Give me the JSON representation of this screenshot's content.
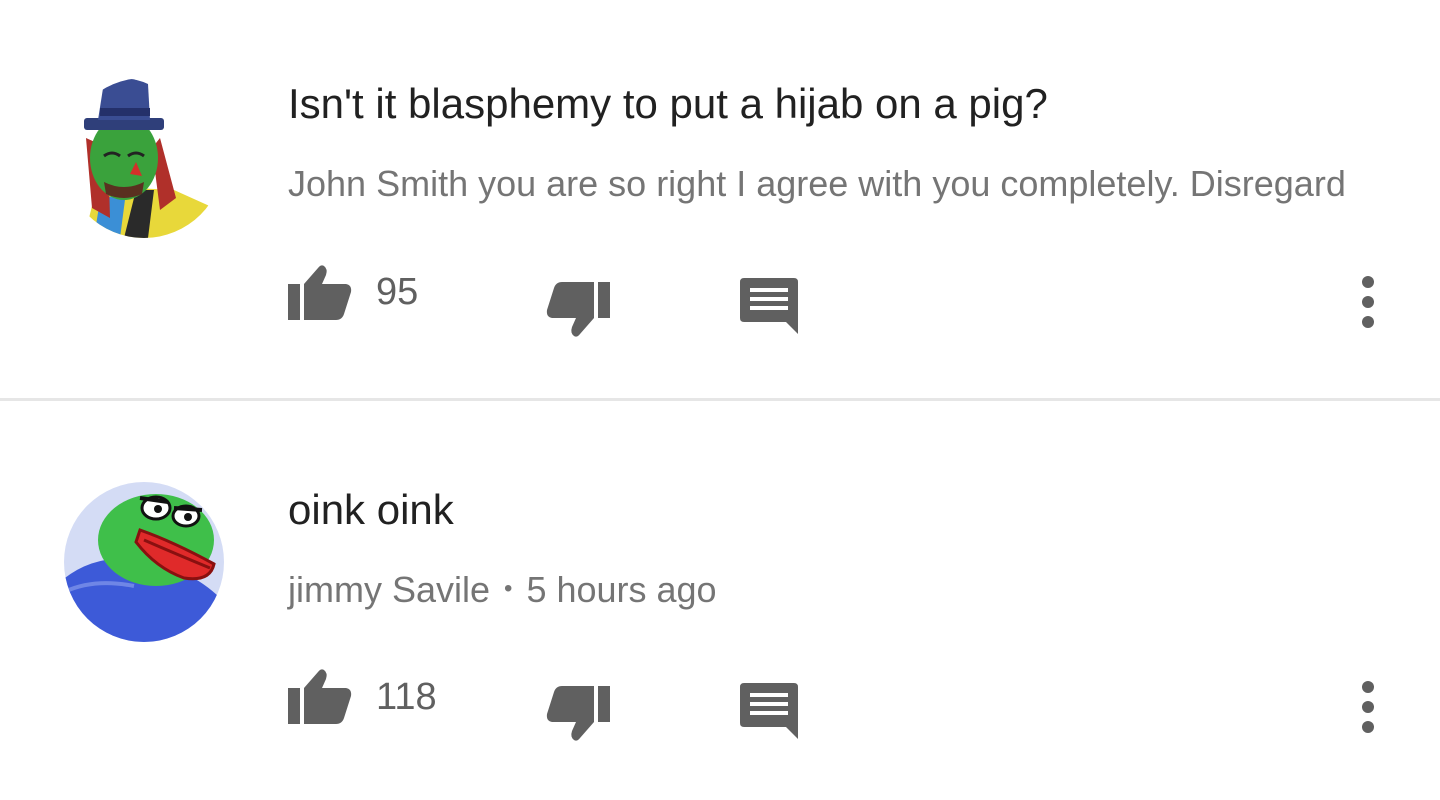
{
  "comments": [
    {
      "text": "Isn't it blasphemy to put a hijab on a pig?",
      "meta_text": "John Smith you are so right I agree with you completely. Disregard",
      "like_count": "95",
      "avatar_icon": "top-hat-clown-avatar"
    },
    {
      "text": "oink oink",
      "author": "jimmy Savile",
      "separator": "•",
      "timestamp": "5 hours ago",
      "like_count": "118",
      "avatar_icon": "green-frog-avatar"
    }
  ],
  "icons": {
    "like": "thumbs-up-icon",
    "dislike": "thumbs-down-icon",
    "reply": "comment-bubble-icon",
    "more": "more-vertical-icon"
  },
  "colors": {
    "text_primary": "#212121",
    "text_secondary": "#757575",
    "icon_gray": "#606060",
    "divider": "#e6e6e6"
  }
}
